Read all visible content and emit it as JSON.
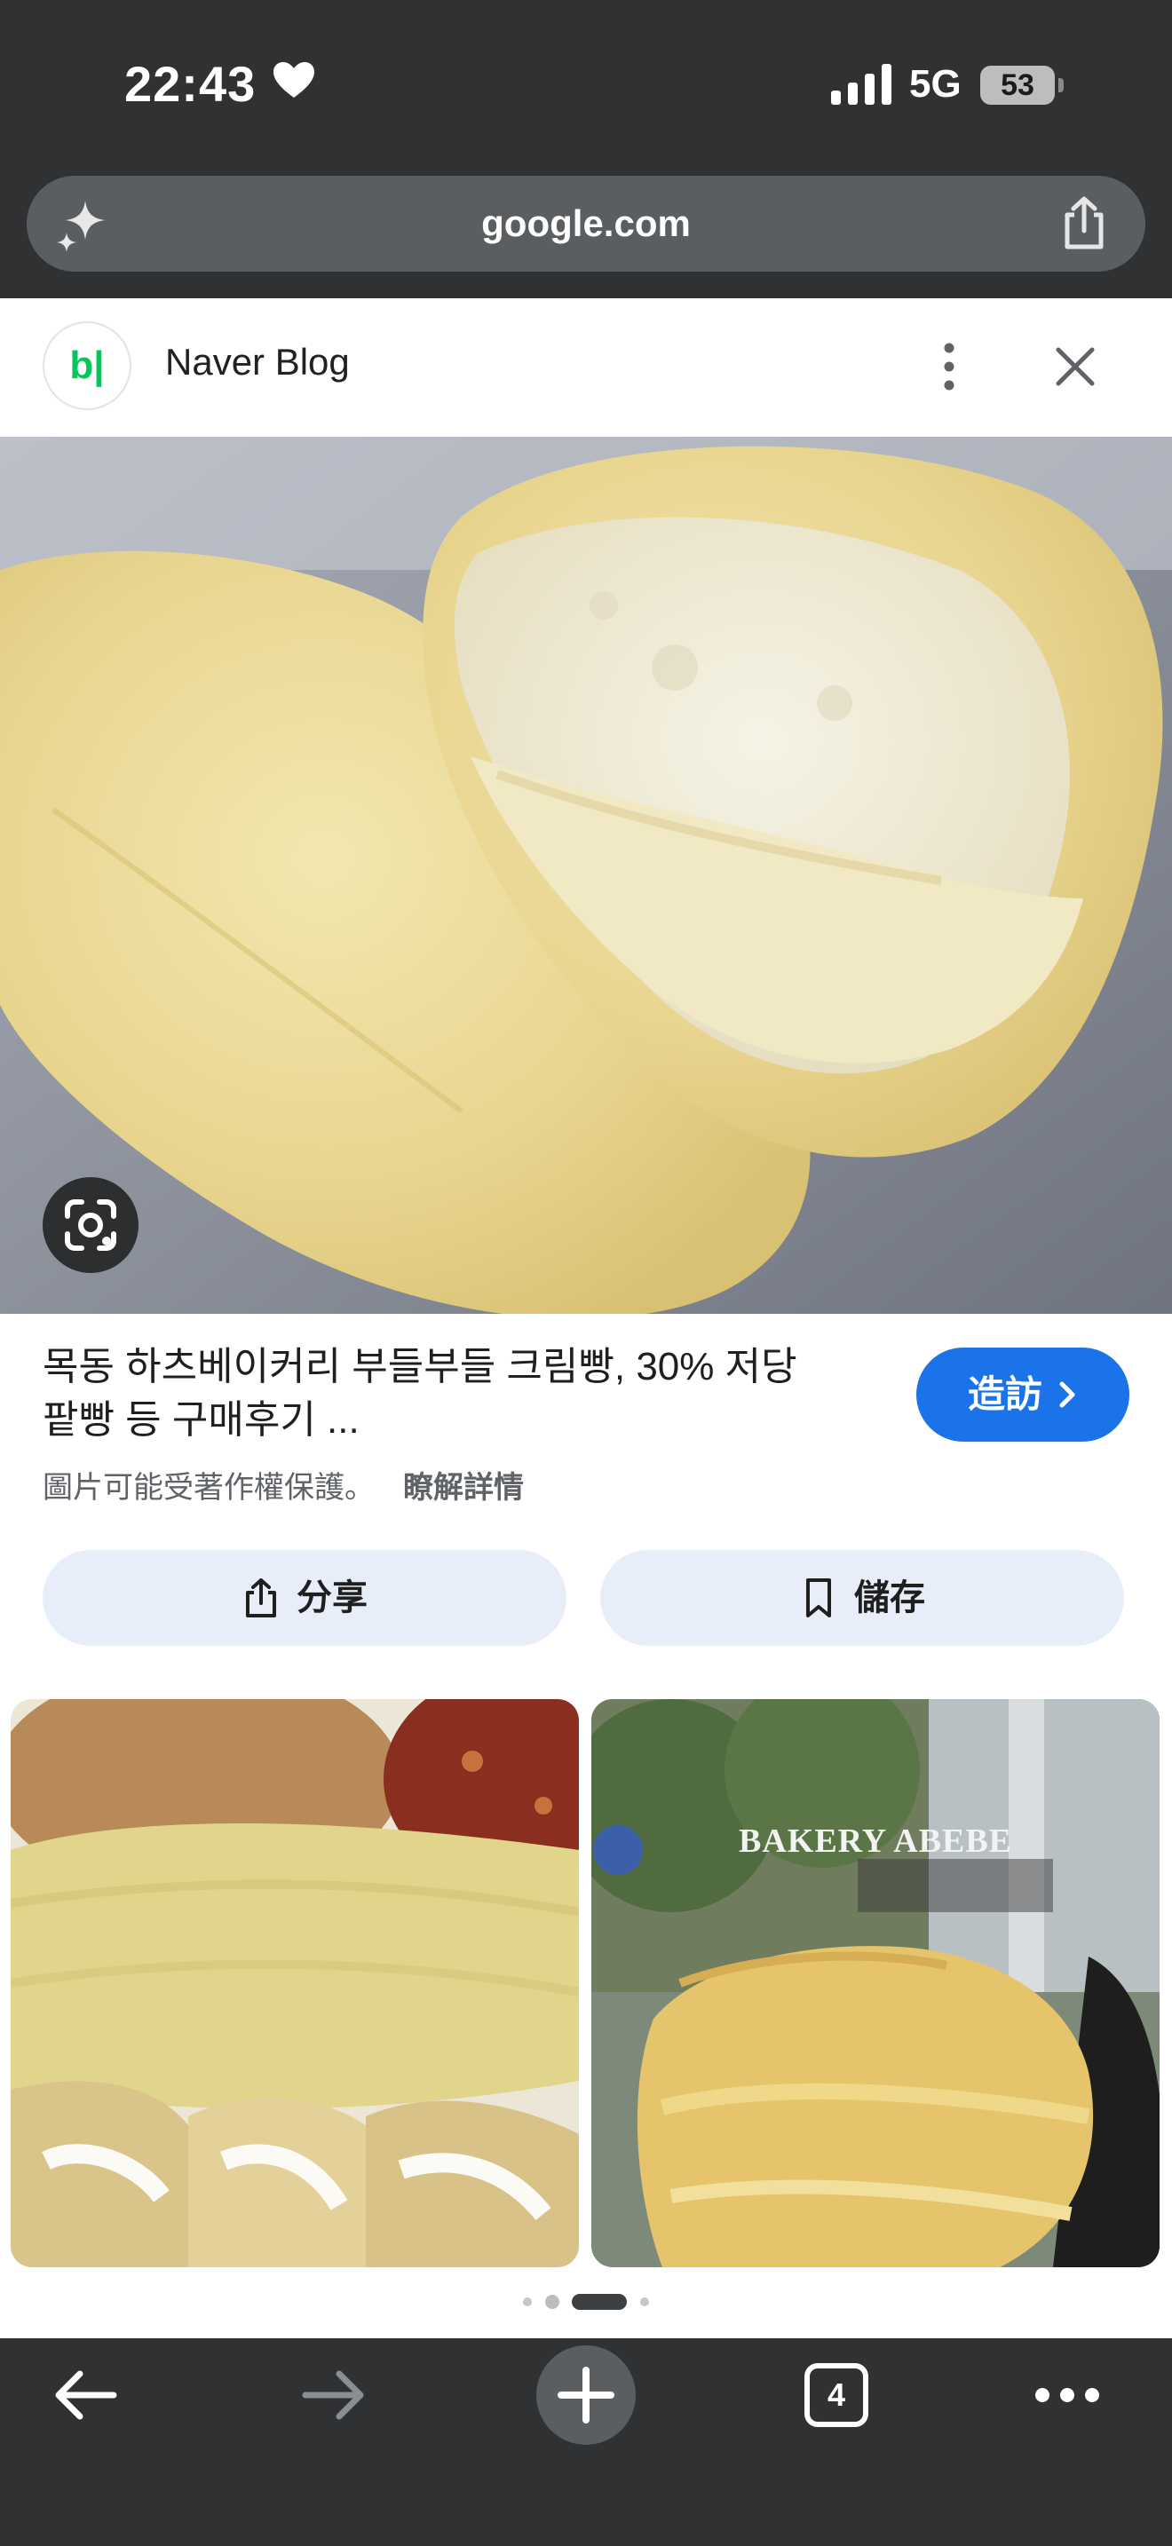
{
  "status_bar": {
    "time": "22:43",
    "network": "5G",
    "battery_level": "53"
  },
  "browser": {
    "url": "google.com"
  },
  "source": {
    "logo_text": "b|",
    "name": "Naver Blog"
  },
  "result": {
    "title_line1": "목동 하츠베이커리 부들부들 크림빵, 30% 저당",
    "title_line2": "팥빵 등 구매후기 ...",
    "visit_label": "造訪",
    "copyright_notice": "圖片可能受著作權保護。",
    "learn_more": "瞭解詳情"
  },
  "actions": {
    "share_label": "分享",
    "save_label": "儲存"
  },
  "related": {
    "thumb2_caption": "BAKERY ABEBE"
  },
  "carousel": {
    "total": 4,
    "active_index": 2
  },
  "toolbar": {
    "tab_count": "4"
  },
  "colors": {
    "accent": "#1a73e8",
    "toolbar_bg": "#2f3133",
    "pill_bg": "#e8eef9",
    "naver_green": "#03c75a"
  }
}
